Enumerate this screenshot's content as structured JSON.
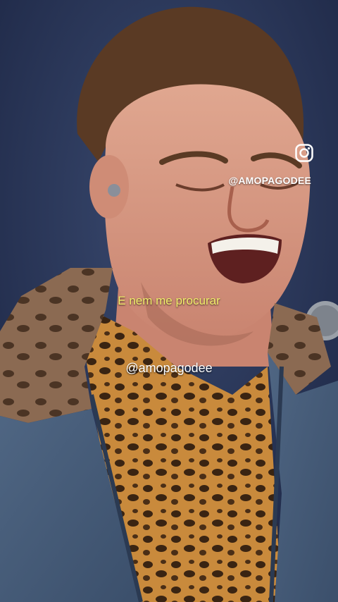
{
  "video": {
    "watermark_icon": "instagram-icon",
    "watermark_handle": "@AMOPAGODEE",
    "caption": "E nem me procurar",
    "center_handle": "@amopagodee",
    "caption_color": "#f3ee6b",
    "background_color": "#1f2a44"
  }
}
